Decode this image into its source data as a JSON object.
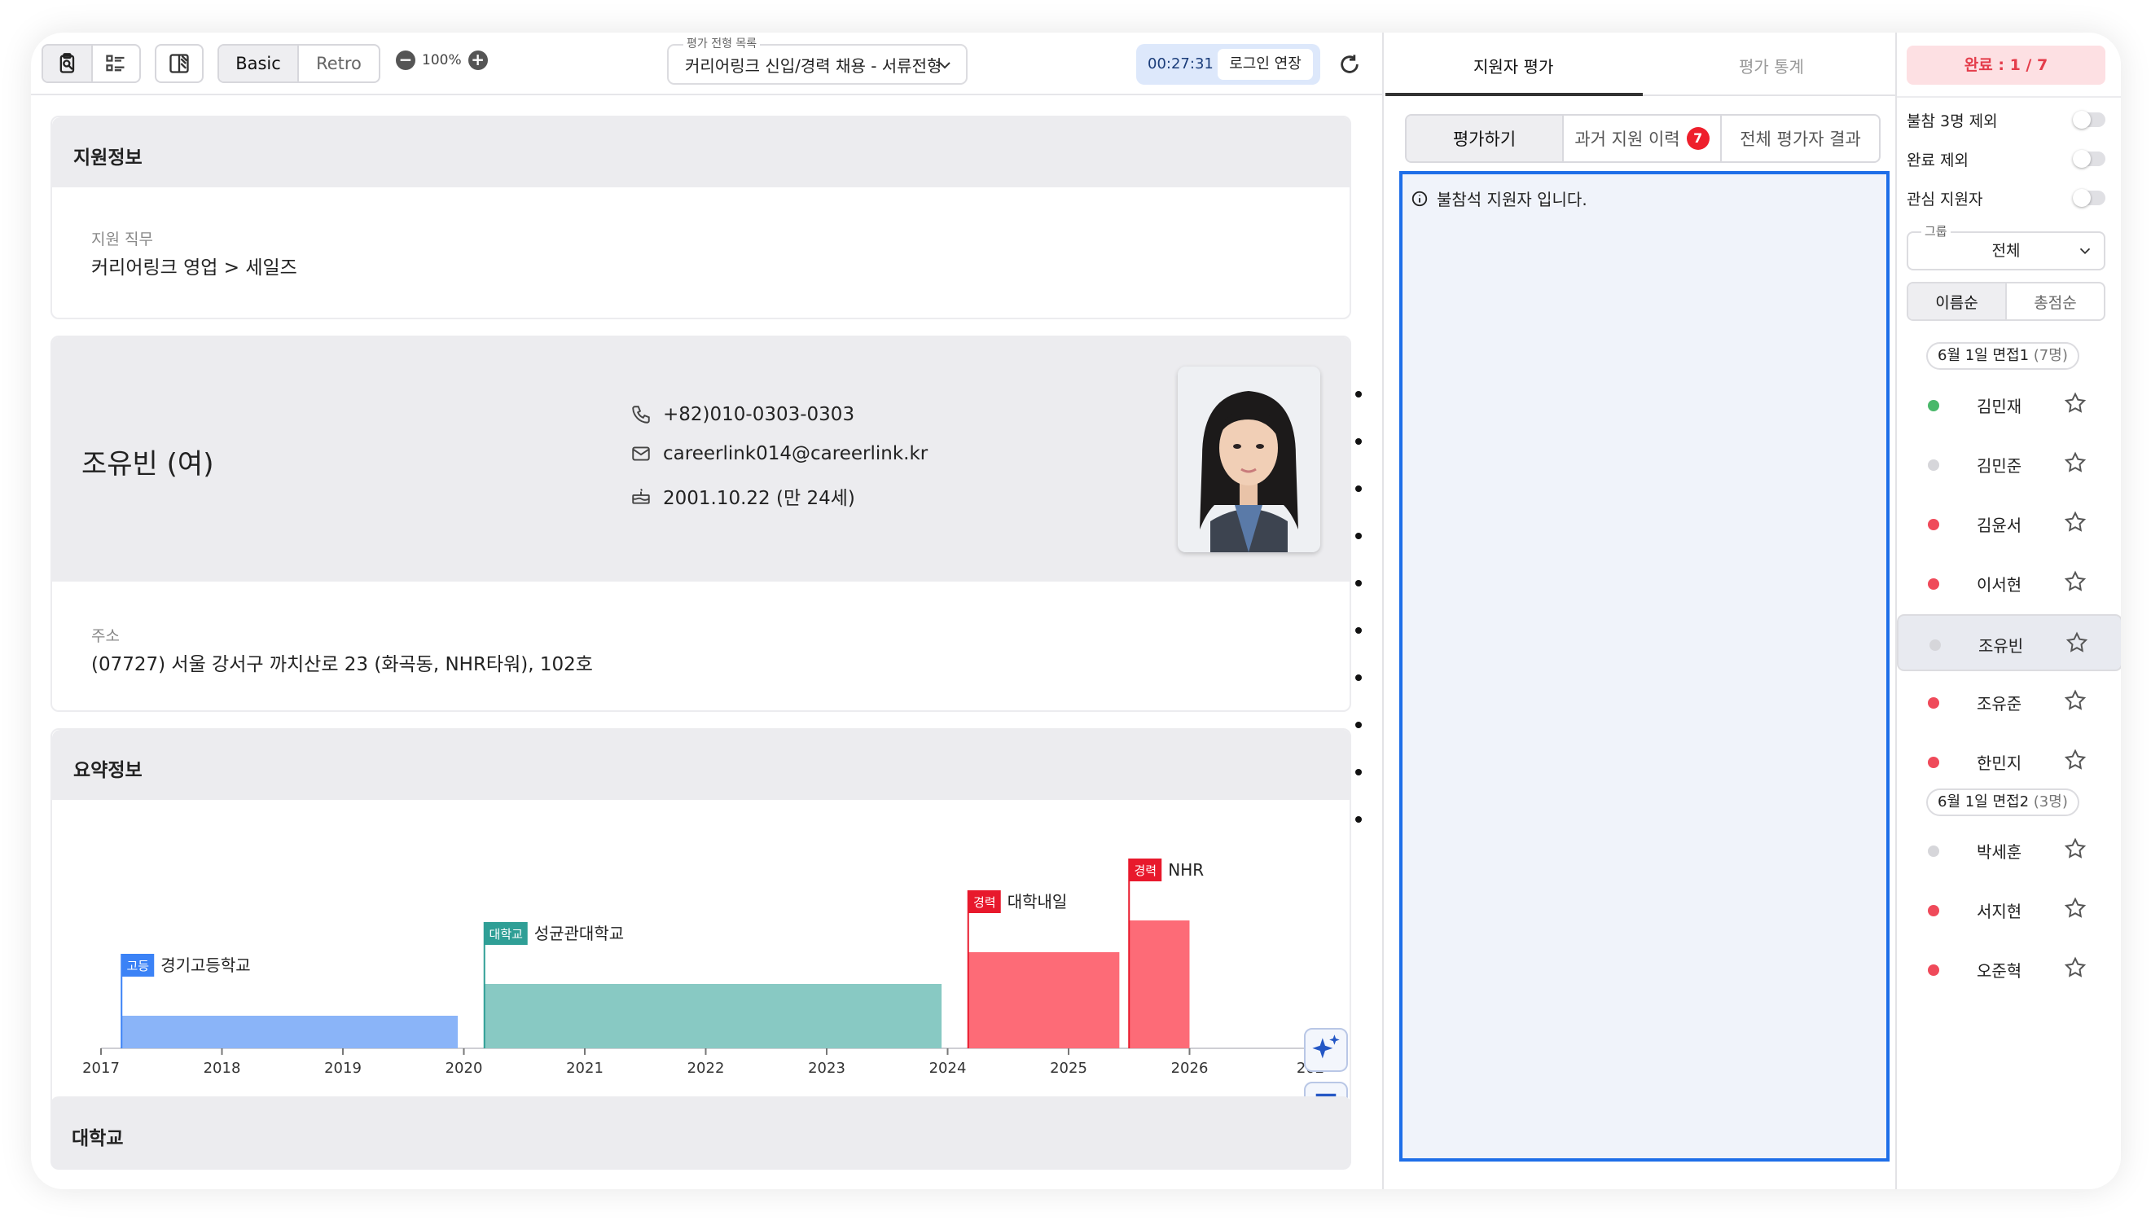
{
  "toolbar": {
    "mode_basic": "Basic",
    "mode_retro": "Retro",
    "zoom": "100%",
    "select_label": "평가 전형 목록",
    "select_value": "커리어링크 신입/경력 채용 - 서류전형",
    "timer": "00:27:31",
    "extend_label": "로그인 연장"
  },
  "application": {
    "section_title": "지원정보",
    "job_label": "지원 직무",
    "job_value": "커리어링크 영업 > 세일즈"
  },
  "profile": {
    "name": "조유빈 (여)",
    "phone": "+82)010-0303-0303",
    "email": "careerlink014@careerlink.kr",
    "birth": "2001.10.22 (만 24세)",
    "address_label": "주소",
    "address_value": "(07727) 서울 강서구 까치산로 23 (화곡동, NHR타워), 102호"
  },
  "summary": {
    "section_title": "요약정보"
  },
  "chart_data": {
    "type": "timeline",
    "x_ticks": [
      "2017",
      "2018",
      "2019",
      "2020",
      "2021",
      "2022",
      "2023",
      "2024",
      "2025",
      "2026",
      "202"
    ],
    "x_range": [
      2017,
      2027
    ],
    "entries": [
      {
        "tag": "고등",
        "name": "경기고등학교",
        "start": 2017.17,
        "end": 2019.95,
        "level": 1,
        "color": "#8ab4f8",
        "tag_color": "#3b82f6"
      },
      {
        "tag": "대학교",
        "name": "성균관대학교",
        "start": 2020.17,
        "end": 2023.95,
        "level": 2,
        "color": "#88c9c3",
        "tag_color": "#2f9f96"
      },
      {
        "tag": "경력",
        "name": "대학내일",
        "start": 2024.17,
        "end": 2025.42,
        "level": 3,
        "color": "#fd6b77",
        "tag_color": "#e8192c"
      },
      {
        "tag": "경력",
        "name": "NHR",
        "start": 2025.5,
        "end": 2026.0,
        "level": 4,
        "color": "#fd6b77",
        "tag_color": "#e8192c"
      }
    ]
  },
  "university": {
    "section_title": "대학교"
  },
  "middle": {
    "tab_eval": "지원자 평가",
    "tab_stats": "평가 통계",
    "seg_eval": "평가하기",
    "seg_history": "과거 지원 이력",
    "history_count": "7",
    "seg_all": "전체 평가자 결과",
    "notice": "불참석 지원자 입니다."
  },
  "right": {
    "done": "완료 : 1 / 7",
    "filter_absent": "불참 3명 제외",
    "filter_done": "완료 제외",
    "filter_interest": "관심 지원자",
    "group_label": "그룹",
    "group_value": "전체",
    "sort_name": "이름순",
    "sort_score": "총점순",
    "group1": "6월 1일 면접1",
    "group1_count": "(7명)",
    "group2": "6월 1일 면접2",
    "group2_count": "(3명)",
    "candidates1": [
      {
        "name": "김민재",
        "status": "#49b86a"
      },
      {
        "name": "김민준",
        "status": "#d6d6da"
      },
      {
        "name": "김윤서",
        "status": "#ef4a5a"
      },
      {
        "name": "이서현",
        "status": "#ef4a5a"
      },
      {
        "name": "조유빈",
        "status": "#d6d6da"
      },
      {
        "name": "조유준",
        "status": "#ef4a5a"
      },
      {
        "name": "한민지",
        "status": "#ef4a5a"
      }
    ],
    "candidates2": [
      {
        "name": "박세훈",
        "status": "#d6d6da"
      },
      {
        "name": "서지현",
        "status": "#ef4a5a"
      },
      {
        "name": "오준혁",
        "status": "#ef4a5a"
      }
    ]
  }
}
